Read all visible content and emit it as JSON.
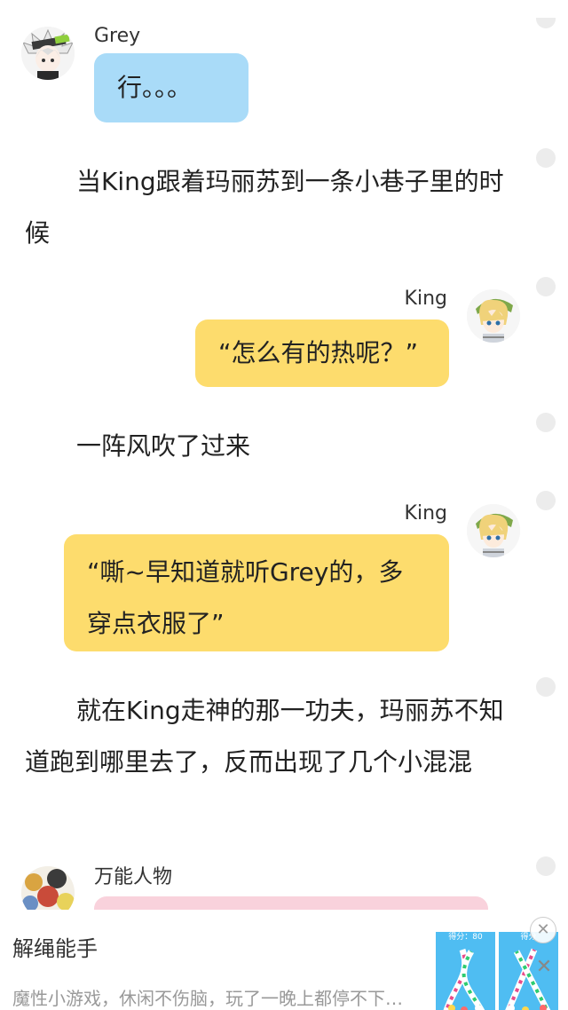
{
  "messages": {
    "m1": {
      "speaker": "Grey",
      "text": "行。。。"
    },
    "n1": {
      "text": "当King跟着玛丽苏到一条小巷子里的时候"
    },
    "m2": {
      "speaker": "King",
      "text": "“怎么有的热呢？”"
    },
    "n2": {
      "text": "一阵风吹了过来"
    },
    "m3": {
      "speaker": "King",
      "text": "“嘶~早知道就听Grey的，多穿点衣服了”"
    },
    "n3": {
      "text": "就在King走神的那一功夫，玛丽苏不知道跑到哪里去了，反而出现了几个小混混"
    },
    "m4": {
      "speaker": "万能人物",
      "text": ""
    }
  },
  "ad": {
    "title": "解绳能手",
    "description": "魔性小游戏，休闲不伤脑，玩了一晚上都停不下…",
    "thumb1_score": "得分：80",
    "thumb2_score": "得分",
    "close_icon": "close-circle-icon",
    "dismiss_icon": "x-icon"
  },
  "colors": {
    "grey_bubble": "#a9dbf8",
    "king_bubble": "#fddc6d",
    "other_bubble": "#f9d2dc",
    "rail_dot": "#ececec"
  }
}
